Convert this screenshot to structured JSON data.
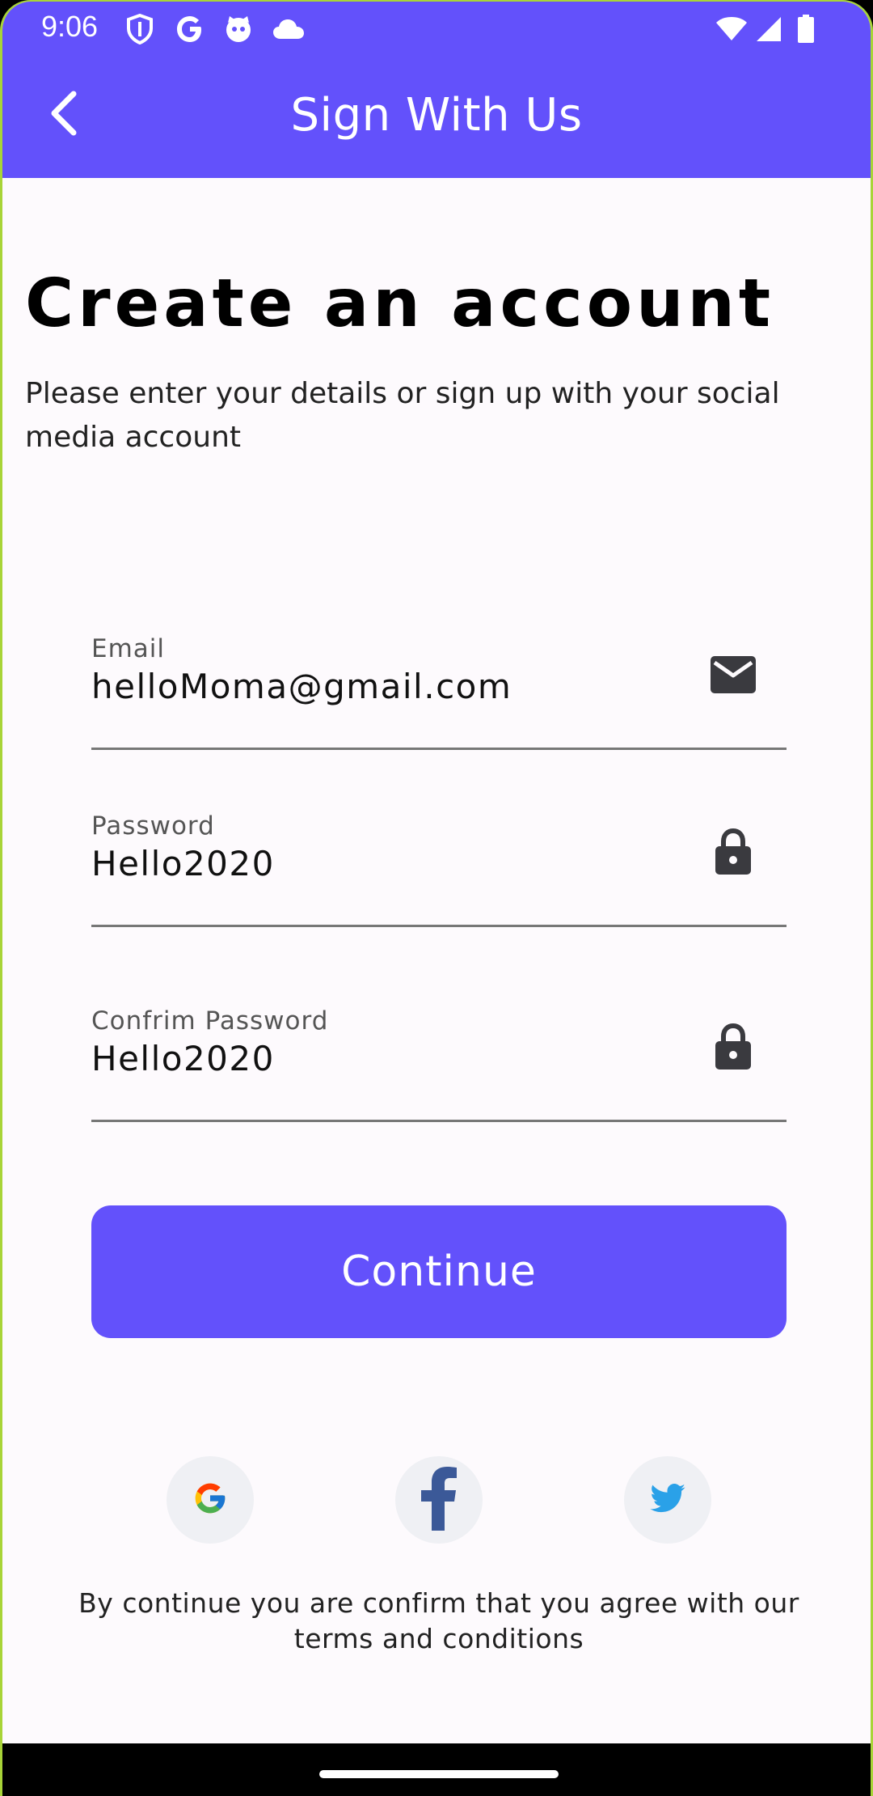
{
  "status_bar": {
    "time": "9:06",
    "icons": [
      "shield-icon",
      "google-g-icon",
      "cat-icon",
      "cloud-icon",
      "wifi-icon",
      "signal-icon",
      "battery-icon"
    ]
  },
  "header": {
    "title": "Sign With Us",
    "back_icon": "chevron-left-icon",
    "color": "#6351fb"
  },
  "page": {
    "heading": "Create an account",
    "subtitle": "Please enter your details or sign up with your social media account"
  },
  "form": {
    "email": {
      "label": "Email",
      "value": "helloMoma@gmail.com",
      "icon": "mail-icon"
    },
    "password": {
      "label": "Password",
      "value": "Hello2020",
      "icon": "lock-icon"
    },
    "confirm_password": {
      "label": "Confrim Password",
      "value": "Hello2020",
      "icon": "lock-icon"
    },
    "continue_label": "Continue"
  },
  "social": {
    "buttons": [
      "google-icon",
      "facebook-icon",
      "twitter-icon"
    ]
  },
  "footer": {
    "terms": "By continue you are confirm that you agree with our terms and conditions"
  }
}
